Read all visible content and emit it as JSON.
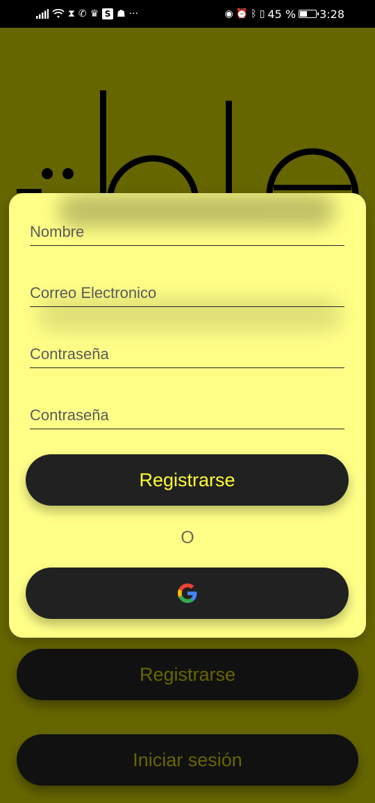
{
  "status_bar": {
    "left_icons": [
      "signal-icon",
      "wifi-icon",
      "hourglass-icon",
      "whatsapp-icon",
      "trophy-icon",
      "s-app-icon",
      "game-icon"
    ],
    "more": "···",
    "s_label": "S",
    "battery_percent": "45 %",
    "battery_level": 0.45,
    "time": "3:28"
  },
  "form": {
    "name_placeholder": "Nombre",
    "email_placeholder": "Correo Electronico",
    "password_placeholder": "Contraseña",
    "confirm_password_placeholder": "Contraseña",
    "register_label": "Registrarse",
    "or_label": "O",
    "google_icon": "google-icon"
  },
  "background_buttons": {
    "register_label": "Registrarse",
    "login_label": "Iniciar sesión"
  },
  "colors": {
    "background": "#666600",
    "card": "#ffff88",
    "button": "#212121",
    "button_text": "#ffff33"
  }
}
